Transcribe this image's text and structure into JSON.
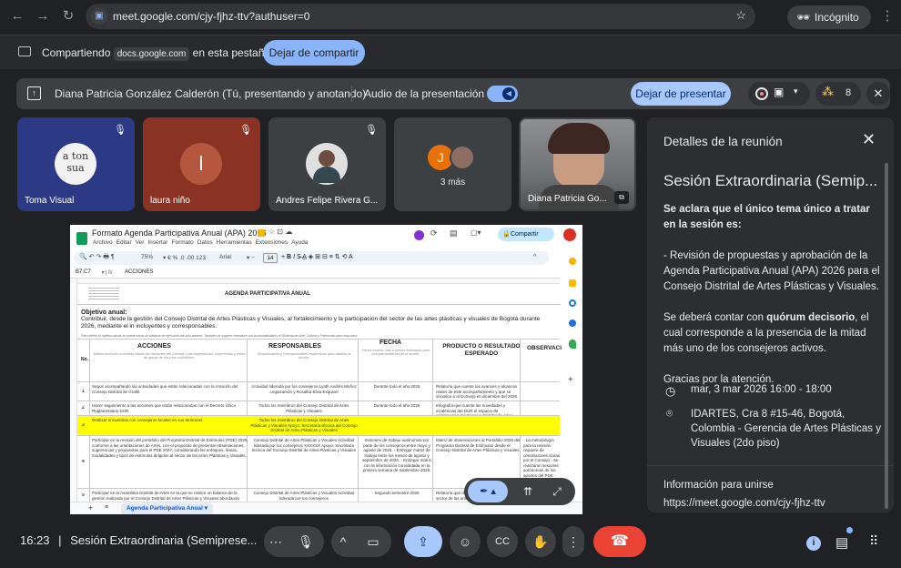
{
  "browser": {
    "url": "meet.google.com/cjy-fjhz-ttv?authuser=0",
    "incognito_label": "Incógnito"
  },
  "share_bar": {
    "prefix": "Compartiendo",
    "site_chip": "docs.google.com",
    "suffix": "en esta pestaña",
    "stop_label": "Dejar de compartir"
  },
  "present_bar": {
    "presenter": "Diana Patricia González Calderón (Tú, presentando y anotando)",
    "audio_label": "Audio de la presentación",
    "stop_label": "Dejar de presentar",
    "people_count": "8"
  },
  "tiles": [
    {
      "name": "Toma Visual",
      "bg": "#2c3a86",
      "avatar_text": "a ton sua"
    },
    {
      "name": "laura niño",
      "bg": "#8a3324",
      "avatar_text": "l",
      "avatar_bg": "#b5573e"
    },
    {
      "name": "Andres Felipe Rivera G...",
      "bg": "#3c4043"
    },
    {
      "name": "3 más",
      "bg": "#3c4043",
      "avatar_text": "J"
    },
    {
      "name": "Diana Patricia Go...",
      "bg": "#5f6368"
    }
  ],
  "sheet": {
    "doc_title": "Formato Agenda Participativa Anual (APA) 2026",
    "menus": [
      "Archivo",
      "Editar",
      "Ver",
      "Insertar",
      "Formato",
      "Datos",
      "Herramientas",
      "Extensiones",
      "Ayuda"
    ],
    "share_label": "Compartir",
    "zoom": "75%",
    "font": "Arial",
    "font_size": "14",
    "cell_ref": "B7:C7",
    "formula": "ACCIONES",
    "heading": "AGENDA PARTICIPATIVA ANUAL",
    "objective_label": "Objetivo anual:",
    "objective_text": "Contribuir, desde la gestión del Consejo Distrital de Artes Plásticas y Visuales, al fortalecimiento y la participación del sector de las artes plásticas y visuales de Bogotá durante 2026, mediante el in incluyentes y corresponsables.",
    "note": "Para definir el objetivo anual se puede tomar un balance de ejecución del año anterior. También se sugiere orientarse con la normatividad y el Sistema de Arte, Cultura y Patrimonio para esta área.",
    "columns": [
      "No.",
      "ACCIONES",
      "RESPONSABLES",
      "FECHA",
      "PRODUCTO O RESULTADO ESPERADO",
      "OBSERVACI"
    ],
    "rows": [
      {
        "num": "1",
        "no": "1",
        "accion": "Seguir acompañando las actividades que están relacionadas con la creación del Consejo Distrital de Grafiti.",
        "resp": "Actividad liderada por los consejeros Lyath Andrés Muñoz Legaizamón y Rosalba Elisa Esquivel",
        "fecha": "Durante todo el año 2026",
        "producto": "Relatoría que cuente los avances y alcances reales de este acompañamiento y que se socialice a al Consejo en diciembre del 2026."
      },
      {
        "num": "2",
        "no": "2",
        "accion": "Hacer seguimiento a las acciones que están relacionadas con el Decreto Único Reglamentario DUR",
        "resp": "Todos los miembros del Consejo Distrital de Artes Plásticas y Visuales",
        "fecha": "Durante todo el año 2026",
        "producto": "Infografía que cuente las novedades y incidencias del DUR el espacio de participación del Consejo Distrital de Artes Plásticas y Visuales"
      },
      {
        "num": "3",
        "no": "3",
        "accion": "Realizar encuentros con consejeros locales en sus territorios.",
        "resp": "Todos los miembros del Consejo Distrital de Artes Plásticas y Visuales Apoyo: Secretaría técnica del Consejo Distrital de Artes Plásticas y Visuales",
        "fecha": "",
        "producto": ""
      },
      {
        "num": "4",
        "no": "4",
        "accion": "Participar en la revisión del portafolio del Programa Distrital de Estímulos (PDE) 2026, conforme a las orientaciones de Artes, con el propósito de presentar observaciones, sugerencias y propuestas para el PDE 2027, considerando los enfoques, líneas, modalidades y tipos de estímulos dirigidos al sector de las Artes Plásticas y Visuales.",
        "resp": "Consejo Distrital de Artes Plásticas y Visuales Actividad liderada por los consejeros XXXXXX Apoyo: Secretaría técnica del Consejo Distrital de Artes Plásticas y Visuales",
        "fecha": "Sesiones de trabajo autónomas por parte de los consejeros entre mayo y agosto de 2026. - Entregar matriz de trabajo entre los meses de agosto y septiembre de 2026. - Entregar matriz con la información consolidada en la primera semana de septiembre 2026.",
        "producto": "Matriz de observaciones al Portafolio 2026 del Programa Distrital de Estímulos desde el Consejo Distrital de Artes Plásticas y Visuales"
      },
      {
        "num": "5",
        "no": "5",
        "accion": "Participar en la Asamblea Distrital de Artes en la que se realice un balance de la gestión realizada por el Consejo Distrital de Artes Plásticas y Visuales abordando",
        "resp": "Consejo Distrital de Artes Plásticas y Visuales Actividad liderada por los consejeros",
        "fecha": "Segundo semestre 2026",
        "producto": "Relatoría que dé cuenta de la participación del sector de las artes plásticas y visuales"
      }
    ],
    "row4_obs": "- La metodología para la revisión requiere de orientaciones claras por el Consejo - Se realizaron sesiones autónomas de los aportes del PDE - Propuesta para revisión de PDE 2027 consejeros como insumo desde la sesión - Generar un acta línea a matriz de la sesión",
    "sheet_tab": "Agenda Participativa Anual"
  },
  "panel": {
    "title": "Detalles de la reunión",
    "meeting_title": "Sesión Extraordinaria (Semip...",
    "bold_intro": "Se aclara que el único tema único a tratar en la sesión es:",
    "item": "- Revisión de propuestas y aprobación de la Agenda Participativa Anual (APA) 2026 para el Consejo Distrital de Artes Plásticas y Visuales.",
    "quorum_pre": "Se deberá contar con",
    "quorum_bold": "quórum decisorio",
    "quorum_post": ", el cual corresponde a la presencia de la mitad más uno de los consejeros activos.",
    "thanks": "Gracias por la atención.",
    "datetime": "mar, 3 mar 2026 16:00 - 18:00",
    "location": "IDARTES, Cra 8 #15-46, Bogotá, Colombia - Gerencia de Artes Plásticas y Visuales (2do piso)",
    "join_title": "Información para unirse",
    "join_url": "https://meet.google.com/cjy-fjhz-ttv"
  },
  "bottom": {
    "time": "16:23",
    "separator": "|",
    "meeting_name": "Sesión Extraordinaria (Semiprese..."
  },
  "colors": {
    "accent": "#8ab4f8",
    "hangup": "#ea4335",
    "yellow_row": "#ffff00"
  }
}
